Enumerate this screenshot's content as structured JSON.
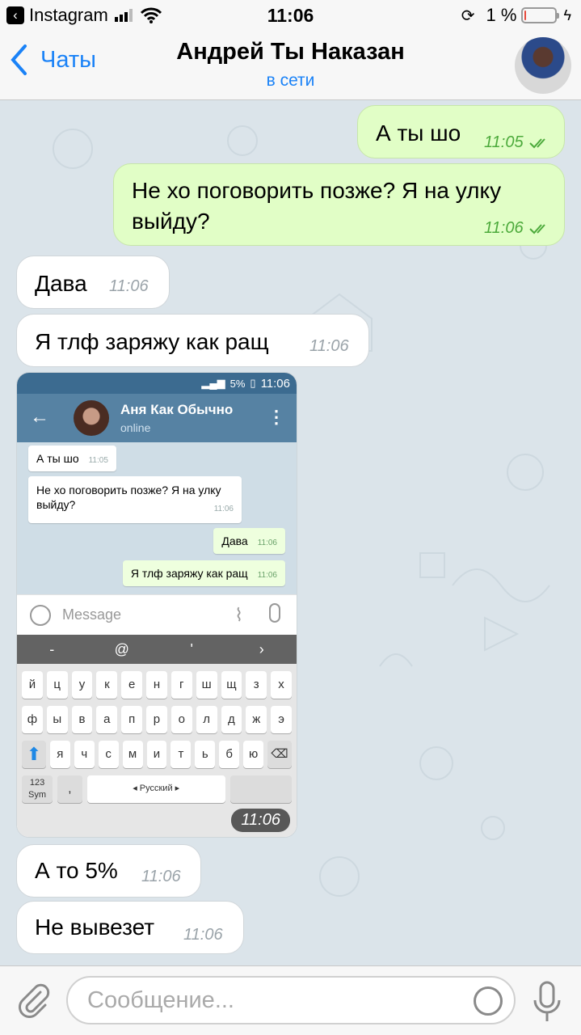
{
  "status_bar": {
    "back_app": "Instagram",
    "time": "11:06",
    "battery": "1 %",
    "battery_level": 0.01
  },
  "nav": {
    "back_label": "Чаты",
    "title": "Андрей Ты Наказан",
    "subtitle": "в сети"
  },
  "messages": [
    {
      "text": "А ты шо",
      "time": "11:05",
      "dir": "out"
    },
    {
      "text": "Не хо поговорить позже? Я на улку выйду?",
      "time": "11:06",
      "dir": "out"
    },
    {
      "text": "Дава",
      "time": "11:06",
      "dir": "in"
    },
    {
      "text": "Я тлф заряжу как ращ",
      "time": "11:06",
      "dir": "in"
    },
    {
      "text": "А то 5%",
      "time": "11:06",
      "dir": "in"
    },
    {
      "text": "Не вывезет",
      "time": "11:06",
      "dir": "in"
    }
  ],
  "photo_message": {
    "time": "11:06",
    "status_bar": {
      "battery": "5%",
      "time": "11:06"
    },
    "chat_name": "Аня Как Обычно",
    "chat_status": "online",
    "messages": [
      {
        "text": "А ты шо",
        "time": "11:05"
      },
      {
        "text": "Не хо поговорить позже? Я на улку выйду?",
        "time": "11:06"
      },
      {
        "text": "Дава",
        "time": "11:06"
      },
      {
        "text": "Я тлф заряжу как ращ",
        "time": "11:06"
      }
    ],
    "input_placeholder": "Message",
    "keyboard": {
      "top": [
        "-",
        "@",
        "'",
        "›"
      ],
      "row1": [
        "й",
        "ц",
        "у",
        "к",
        "е",
        "н",
        "г",
        "ш",
        "щ",
        "з",
        "х"
      ],
      "row2": [
        "ф",
        "ы",
        "в",
        "а",
        "п",
        "р",
        "о",
        "л",
        "д",
        "ж",
        "э"
      ],
      "row3": [
        "я",
        "ч",
        "с",
        "м",
        "и",
        "т",
        "ь",
        "б",
        "ю"
      ],
      "sym": "123 Sym",
      "lang": "◂ Русский ▸"
    }
  },
  "input": {
    "placeholder": "Сообщение..."
  }
}
